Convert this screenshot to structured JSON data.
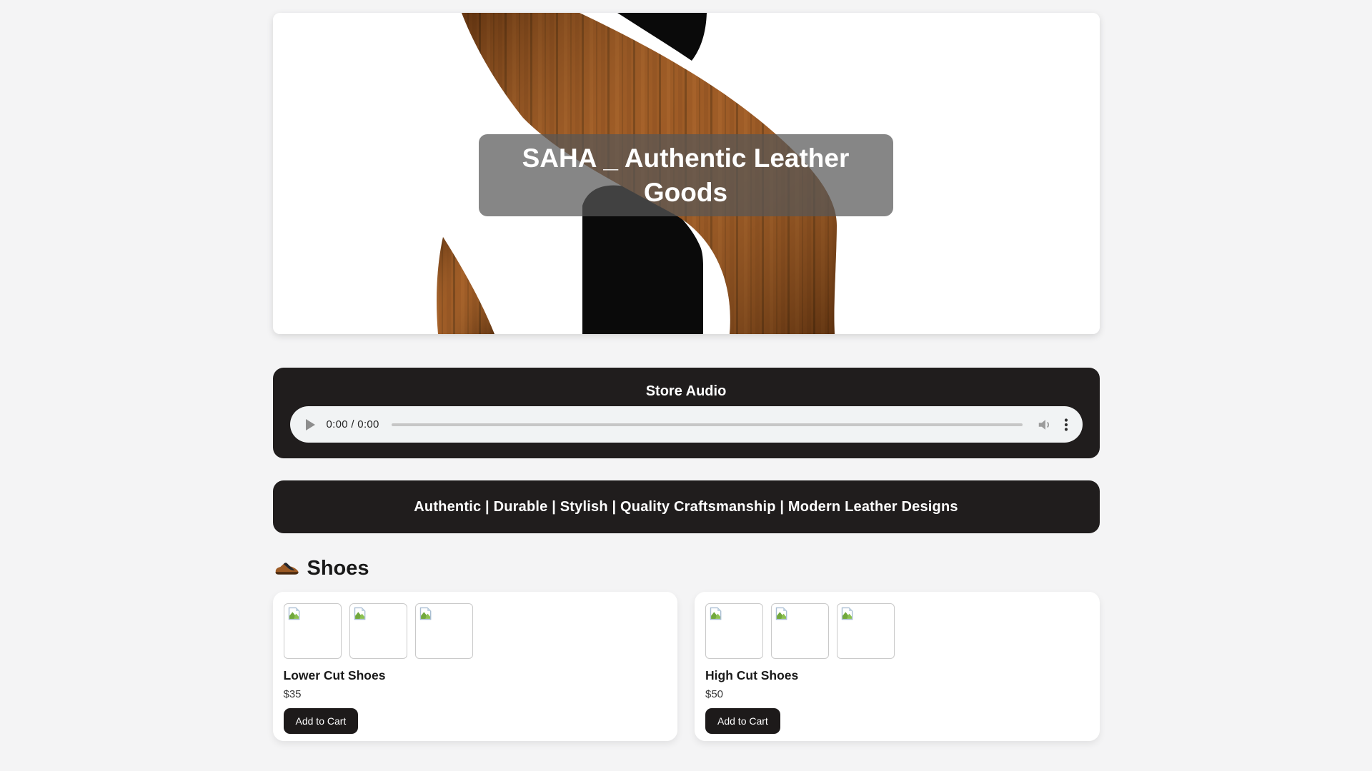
{
  "page": {
    "background_color": "#f4f4f5",
    "panel_color": "#201d1d"
  },
  "hero": {
    "caption": "SAHA _ Authentic Leather Goods",
    "logo_letter": "S",
    "logo_icon": "wood-letter-s-logo",
    "colors": {
      "wood_base": "#8e4d1d",
      "wood_dark_line": "#4a280c",
      "logo_black": "#0a0a0a",
      "caption_bg": "rgba(88,88,88,0.72)"
    }
  },
  "audio_section": {
    "title": "Store Audio",
    "player": {
      "time": "0:00 / 0:00",
      "play_icon": "play-icon",
      "volume_icon": "volume-icon",
      "menu_icon": "kebab-menu-icon"
    }
  },
  "tagline": "Authentic | Durable | Stylish | Quality Craftsmanship | Modern Leather Designs",
  "shoes_section": {
    "icon": "shoe-icon",
    "title": "Shoes",
    "products": [
      {
        "name": "Lower Cut Shoes",
        "price": "$35",
        "button_label": "Add to Cart",
        "thumbnail_icon": "broken-image-icon"
      },
      {
        "name": "High Cut Shoes",
        "price": "$50",
        "button_label": "Add to Cart",
        "thumbnail_icon": "broken-image-icon"
      }
    ]
  }
}
